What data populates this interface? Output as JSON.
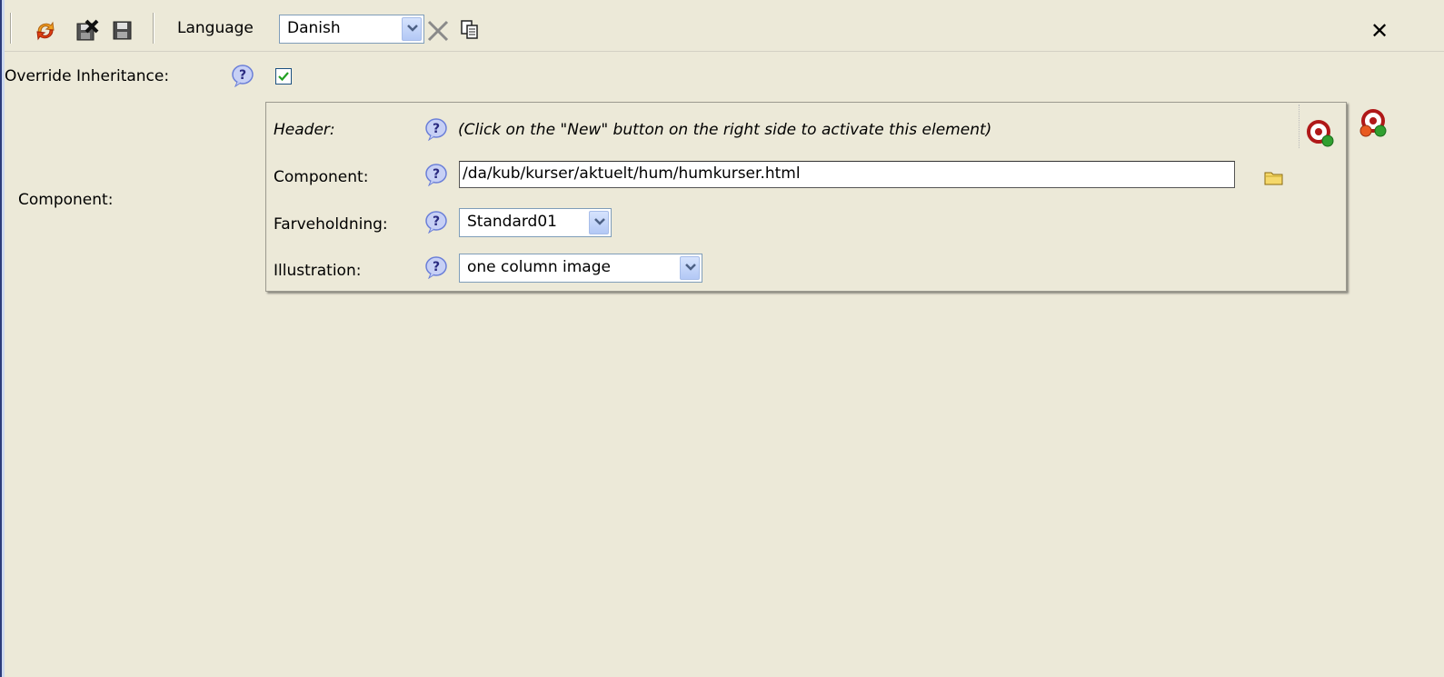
{
  "toolbar": {
    "language_label": "Language",
    "language_value": "Danish",
    "icons": [
      "publish-icon",
      "delete-save-icon",
      "save-icon",
      "clear-icon",
      "copy-icon"
    ],
    "close_label": "✕"
  },
  "form": {
    "override_label": "Override Inheritance:",
    "override_checked": true,
    "component_label": "Component:"
  },
  "panel": {
    "header_label": "Header:",
    "header_hint": "(Click on the \"New\" button on the right side to activate this element)",
    "component_label": "Component:",
    "component_value": "/da/kub/kurser/aktuelt/hum/humkurser.html",
    "farve_label": "Farveholdning:",
    "farve_value": "Standard01",
    "illustration_label": "Illustration:",
    "illustration_value": "one column image"
  },
  "colors": {
    "background": "#ece9d8",
    "help": "#6b7fd8"
  }
}
